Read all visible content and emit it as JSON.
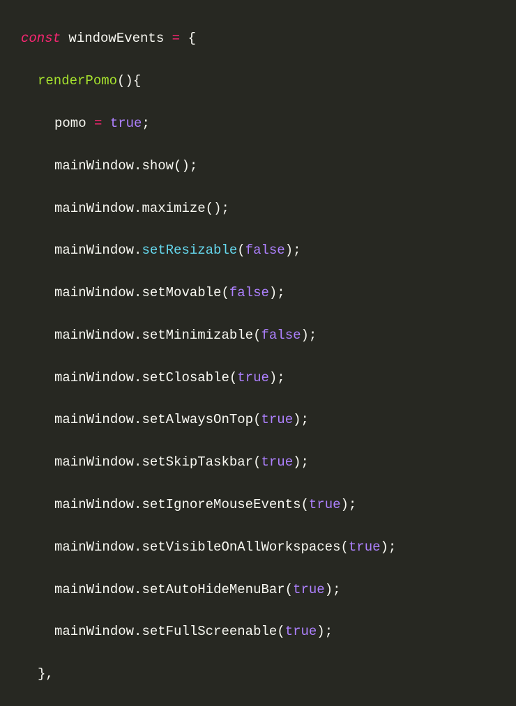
{
  "code": {
    "l1": {
      "kw": "const",
      "id": " windowEvents ",
      "eq": "=",
      "sp": " ",
      "brace": "{"
    },
    "l2": {
      "fn": "renderPomo",
      "paren": "()",
      "brace": "{"
    },
    "l3": {
      "id": "pomo ",
      "eq": "=",
      "sp": " ",
      "bool": "true",
      "semi": ";"
    },
    "l4": {
      "obj": "mainWindow",
      "dot": ".",
      "call": "show",
      "paren1": "(",
      "paren2": ")",
      "semi": ";"
    },
    "l5": {
      "obj": "mainWindow",
      "dot": ".",
      "call": "maximize",
      "paren1": "(",
      "paren2": ")",
      "semi": ";"
    },
    "l6": {
      "obj": "mainWindow",
      "dot": ".",
      "call": "setResizable",
      "paren1": "(",
      "bool": "false",
      "paren2": ")",
      "semi": ";"
    },
    "l7": {
      "obj": "mainWindow",
      "dot": ".",
      "call": "setMovable",
      "paren1": "(",
      "bool": "false",
      "paren2": ")",
      "semi": ";"
    },
    "l8": {
      "obj": "mainWindow",
      "dot": ".",
      "call": "setMinimizable",
      "paren1": "(",
      "bool": "false",
      "paren2": ")",
      "semi": ";"
    },
    "l9": {
      "obj": "mainWindow",
      "dot": ".",
      "call": "setClosable",
      "paren1": "(",
      "bool": "true",
      "paren2": ")",
      "semi": ";"
    },
    "l10": {
      "obj": "mainWindow",
      "dot": ".",
      "call": "setAlwaysOnTop",
      "paren1": "(",
      "bool": "true",
      "paren2": ")",
      "semi": ";"
    },
    "l11": {
      "obj": "mainWindow",
      "dot": ".",
      "call": "setSkipTaskbar",
      "paren1": "(",
      "bool": "true",
      "paren2": ")",
      "semi": ";"
    },
    "l12": {
      "obj": "mainWindow",
      "dot": ".",
      "call": "setIgnoreMouseEvents",
      "paren1": "(",
      "bool": "true",
      "paren2": ")",
      "semi": ";"
    },
    "l13": {
      "obj": "mainWindow",
      "dot": ".",
      "call": "setVisibleOnAllWorkspaces",
      "paren1": "(",
      "bool": "true",
      "paren2": ")",
      "semi": ";"
    },
    "l14": {
      "obj": "mainWindow",
      "dot": ".",
      "call": "setAutoHideMenuBar",
      "paren1": "(",
      "bool": "true",
      "paren2": ")",
      "semi": ";"
    },
    "l15": {
      "obj": "mainWindow",
      "dot": ".",
      "call": "setFullScreenable",
      "paren1": "(",
      "bool": "true",
      "paren2": ")",
      "semi": ";"
    },
    "l16": {
      "brace": "}",
      "comma": ","
    }
  }
}
